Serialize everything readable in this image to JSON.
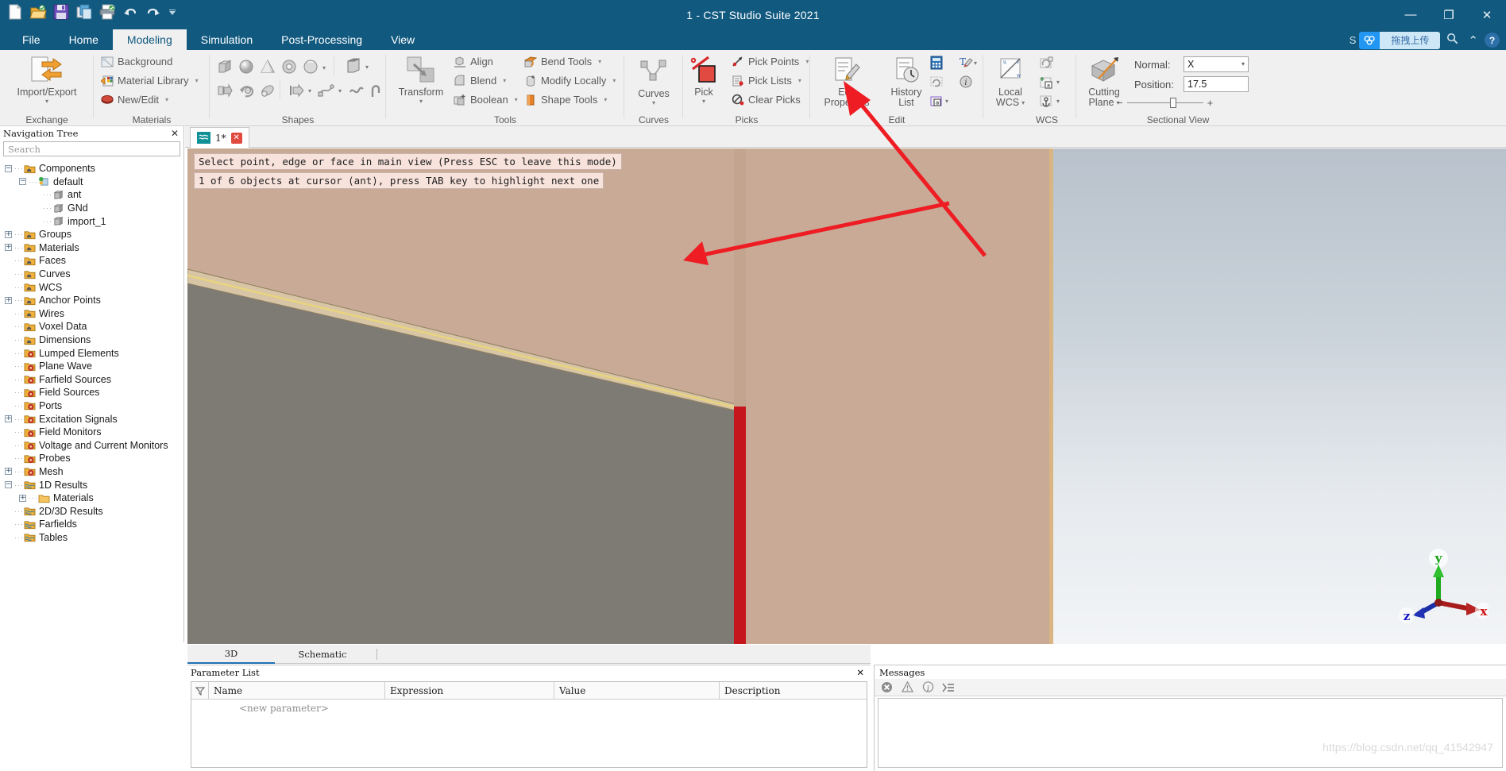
{
  "window": {
    "title": "1 - CST Studio Suite 2021",
    "minimize": "—",
    "maximize": "❐",
    "close": "✕"
  },
  "quick_access": [
    "new-icon",
    "open-icon",
    "save-icon",
    "copy-icon",
    "print-icon",
    "undo-icon",
    "redo-icon",
    "qat-more-icon"
  ],
  "ribbon_tabs": [
    {
      "label": "File",
      "active": false
    },
    {
      "label": "Home",
      "active": false
    },
    {
      "label": "Modeling",
      "active": true
    },
    {
      "label": "Simulation",
      "active": false
    },
    {
      "label": "Post-Processing",
      "active": false
    },
    {
      "label": "View",
      "active": false
    }
  ],
  "topright": {
    "s_label": "S",
    "badge_text": "拖拽上传",
    "search_icon": "search-icon",
    "collapse_icon": "⌃",
    "help_label": "?"
  },
  "ribbon": {
    "groups": [
      {
        "name": "Exchange",
        "label": "Exchange"
      },
      {
        "name": "Materials",
        "label": "Materials"
      },
      {
        "name": "Shapes",
        "label": "Shapes"
      },
      {
        "name": "Tools",
        "label": "Tools"
      },
      {
        "name": "Curves",
        "label": "Curves"
      },
      {
        "name": "Picks",
        "label": "Picks"
      },
      {
        "name": "Edit",
        "label": "Edit"
      },
      {
        "name": "WCS",
        "label": "WCS"
      },
      {
        "name": "Sectional View",
        "label": "Sectional View"
      }
    ],
    "import_export": "Import/Export",
    "materials": [
      {
        "label": "Background",
        "icon": "background-icon",
        "caret": false
      },
      {
        "label": "Material Library",
        "icon": "material-library-icon",
        "caret": true
      },
      {
        "label": "New/Edit",
        "icon": "new-edit-icon",
        "caret": true
      }
    ],
    "transform": "Transform",
    "tools_items": [
      {
        "label": "Align",
        "icon": "align-icon",
        "caret": false
      },
      {
        "label": "Blend",
        "icon": "blend-icon",
        "caret": true
      },
      {
        "label": "Boolean",
        "icon": "boolean-icon",
        "caret": true
      },
      {
        "label": "Bend Tools",
        "icon": "bend-tools-icon",
        "caret": true
      },
      {
        "label": "Modify Locally",
        "icon": "modify-locally-icon",
        "caret": true
      },
      {
        "label": "Shape Tools",
        "icon": "shape-tools-icon",
        "caret": true
      }
    ],
    "curves": "Curves",
    "picks": "Pick",
    "picks_items": [
      {
        "label": "Pick Points",
        "icon": "pick-points-icon",
        "caret": true
      },
      {
        "label": "Pick Lists",
        "icon": "pick-lists-icon",
        "caret": true
      },
      {
        "label": "Clear Picks",
        "icon": "clear-picks-icon",
        "caret": false
      }
    ],
    "edit_properties": "Edit\nProperties",
    "edit_properties_l1": "Edit",
    "edit_properties_l2": "Properties",
    "history_list_l1": "History",
    "history_list_l2": "List",
    "local_wcs_l1": "Local",
    "local_wcs_l2": "WCS",
    "cutting_plane_l1": "Cutting",
    "cutting_plane_l2": "Plane",
    "sectional": {
      "normal_label": "Normal:",
      "normal_value": "X",
      "position_label": "Position:",
      "position_value": "17.5",
      "minus": "−",
      "plus": "+"
    }
  },
  "nav": {
    "title": "Navigation Tree",
    "close_icon": "✕",
    "search_placeholder": "Search",
    "items": [
      {
        "label": "Components",
        "depth": 0,
        "expander": "minus",
        "icon": "folder-orange"
      },
      {
        "label": "default",
        "depth": 1,
        "expander": "minus",
        "icon": "component-green"
      },
      {
        "label": "ant",
        "depth": 2,
        "expander": "none",
        "icon": "solid-gray"
      },
      {
        "label": "GNd",
        "depth": 2,
        "expander": "none",
        "icon": "solid-gray"
      },
      {
        "label": "import_1",
        "depth": 2,
        "expander": "none",
        "icon": "solid-gray"
      },
      {
        "label": "Groups",
        "depth": 0,
        "expander": "plus",
        "icon": "folder-orange"
      },
      {
        "label": "Materials",
        "depth": 0,
        "expander": "plus",
        "icon": "folder-orange"
      },
      {
        "label": "Faces",
        "depth": 0,
        "expander": "none",
        "icon": "folder-orange"
      },
      {
        "label": "Curves",
        "depth": 0,
        "expander": "none",
        "icon": "folder-orange"
      },
      {
        "label": "WCS",
        "depth": 0,
        "expander": "none",
        "icon": "folder-orange"
      },
      {
        "label": "Anchor Points",
        "depth": 0,
        "expander": "plus",
        "icon": "folder-orange"
      },
      {
        "label": "Wires",
        "depth": 0,
        "expander": "none",
        "icon": "folder-orange"
      },
      {
        "label": "Voxel Data",
        "depth": 0,
        "expander": "none",
        "icon": "folder-orange"
      },
      {
        "label": "Dimensions",
        "depth": 0,
        "expander": "none",
        "icon": "folder-orange"
      },
      {
        "label": "Lumped Elements",
        "depth": 0,
        "expander": "none",
        "icon": "folder-red"
      },
      {
        "label": "Plane Wave",
        "depth": 0,
        "expander": "none",
        "icon": "folder-red"
      },
      {
        "label": "Farfield Sources",
        "depth": 0,
        "expander": "none",
        "icon": "folder-red"
      },
      {
        "label": "Field Sources",
        "depth": 0,
        "expander": "none",
        "icon": "folder-red"
      },
      {
        "label": "Ports",
        "depth": 0,
        "expander": "none",
        "icon": "folder-red"
      },
      {
        "label": "Excitation Signals",
        "depth": 0,
        "expander": "plus",
        "icon": "folder-red"
      },
      {
        "label": "Field Monitors",
        "depth": 0,
        "expander": "none",
        "icon": "folder-red"
      },
      {
        "label": "Voltage and Current Monitors",
        "depth": 0,
        "expander": "none",
        "icon": "folder-red"
      },
      {
        "label": "Probes",
        "depth": 0,
        "expander": "none",
        "icon": "folder-red"
      },
      {
        "label": "Mesh",
        "depth": 0,
        "expander": "plus",
        "icon": "folder-red"
      },
      {
        "label": "1D Results",
        "depth": 0,
        "expander": "minus",
        "icon": "folder-results"
      },
      {
        "label": "Materials",
        "depth": 1,
        "expander": "plus",
        "icon": "folder-plain"
      },
      {
        "label": "2D/3D Results",
        "depth": 0,
        "expander": "none",
        "icon": "folder-results"
      },
      {
        "label": "Farfields",
        "depth": 0,
        "expander": "none",
        "icon": "folder-results"
      },
      {
        "label": "Tables",
        "depth": 0,
        "expander": "none",
        "icon": "folder-results"
      }
    ]
  },
  "view_tab": {
    "label": "1*",
    "close": "✕",
    "icon": "wave-icon"
  },
  "viewport": {
    "message_1": "Select point, edge or face in main view (Press ESC to leave this mode)",
    "message_2": "1 of 6 objects at cursor (ant), press TAB key to highlight next one",
    "axes": {
      "x": "x",
      "y": "y",
      "z": "z"
    }
  },
  "bottom_tabs": [
    {
      "label": "3D",
      "active": true
    },
    {
      "label": "Schematic",
      "active": false
    }
  ],
  "parameter_list": {
    "title": "Parameter List",
    "close_icon": "✕",
    "filter_icon": "filter-icon",
    "columns": [
      "Name",
      "Expression",
      "Value",
      "Description"
    ],
    "rows": [],
    "new_parameter_placeholder": "<new parameter>"
  },
  "messages": {
    "title": "Messages",
    "tools": [
      "error-icon",
      "warning-icon",
      "info-icon",
      "list-icon"
    ],
    "body": "",
    "watermark": "https://blog.csdn.net/qq_41542947"
  },
  "colors": {
    "titlebar": "#11597f",
    "ribbon_bg": "#f0f0f0",
    "accent": "#1f6fb2",
    "message_bg": "#f8e3dc",
    "arrow_red": "#ee1c23",
    "model_tan": "#c9ab97",
    "model_gray": "#7d7a74",
    "model_red": "#c4161c"
  }
}
